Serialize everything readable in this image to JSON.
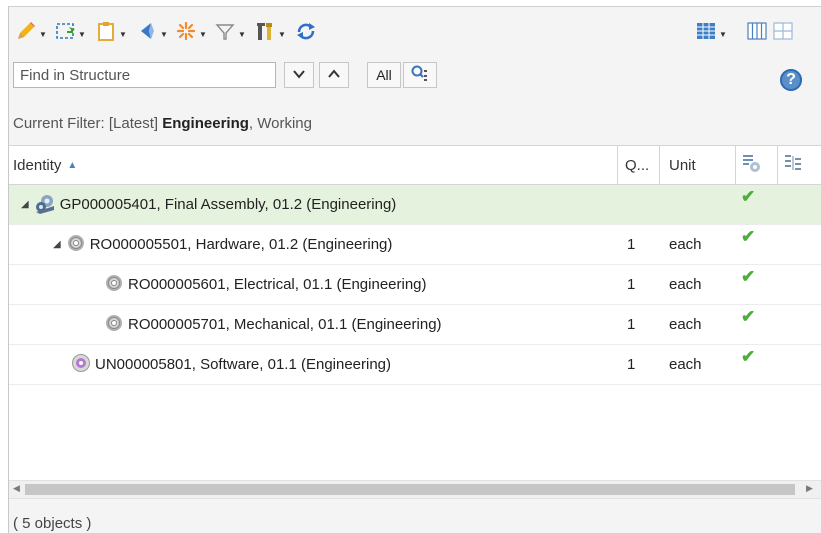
{
  "search": {
    "placeholder": "Find in Structure",
    "all_label": "All"
  },
  "filter": {
    "prefix": "Current Filter: [Latest] ",
    "emphasis": "Engineering",
    "suffix": ", Working"
  },
  "columns": {
    "identity": "Identity",
    "quantity": "Q...",
    "unit": "Unit"
  },
  "rows": [
    {
      "text": "GP000005401, Final Assembly, 01.2 (Engineering)",
      "qty": "",
      "unit": ""
    },
    {
      "text": "RO000005501, Hardware, 01.2 (Engineering)",
      "qty": "1",
      "unit": "each"
    },
    {
      "text": "RO000005601, Electrical, 01.1 (Engineering)",
      "qty": "1",
      "unit": "each"
    },
    {
      "text": "RO000005701, Mechanical, 01.1 (Engineering)",
      "qty": "1",
      "unit": "each"
    },
    {
      "text": "UN000005801, Software, 01.1 (Engineering)",
      "qty": "1",
      "unit": "each"
    }
  ],
  "status": "( 5 objects )",
  "icons": {
    "toolbar": [
      "pencil-icon",
      "insert-icon",
      "clipboard-icon",
      "back-icon",
      "burst-icon",
      "filter-icon",
      "tools-icon",
      "refresh-icon",
      "table-view-icon",
      "columns-icon",
      "grid-icon"
    ],
    "help": "help-icon",
    "check": "check-icon"
  },
  "colors": {
    "selected_row": "#e5f3de",
    "check": "#4cae3c",
    "help": "#5b8fc9"
  }
}
